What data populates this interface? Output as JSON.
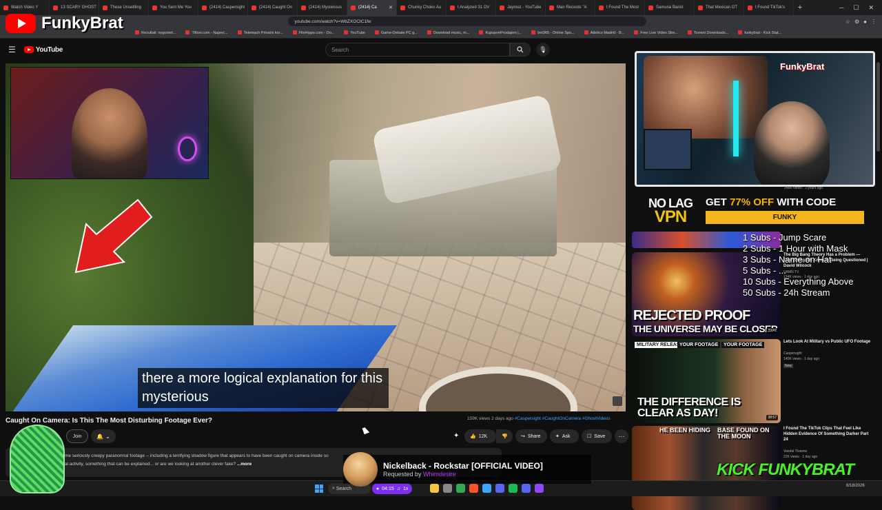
{
  "browser": {
    "tabs": [
      {
        "label": "Watch Video Y"
      },
      {
        "label": "13 SCARY GHOST"
      },
      {
        "label": "These Unsettling"
      },
      {
        "label": "You Sent Me You"
      },
      {
        "label": "(2414) Caspersight"
      },
      {
        "label": "(2414) Caught On"
      },
      {
        "label": "(2414) Mysterious"
      },
      {
        "label": "(2414) Ca",
        "active": true
      },
      {
        "label": "Chunky Choko Au"
      },
      {
        "label": "I Analyzed 31 OV"
      },
      {
        "label": "Jaymez - YouTube"
      },
      {
        "label": "Man Records \"A"
      },
      {
        "label": "I Found The Most"
      },
      {
        "label": "Samurai Barist"
      },
      {
        "label": "That Mexican OT"
      },
      {
        "label": "I Found TikTok's"
      }
    ],
    "url": "youtube.com/watch?v=WbZXOCIC1fw",
    "bookmarks": [
      "Rezultati: nogomet...",
      "Titlovi.com - Najveć...",
      "Telemach Privatni kor...",
      "FileHippo.com - Do...",
      "YouTube",
      "Game-Debate PC g...",
      "Download music, m...",
      "KupujemProdajem |...",
      "bet365 - Online Spo...",
      "Atletico Madrid - B...",
      "Free Live Video Stre...",
      "Torrent Downloads...",
      "funkybrat - Kick Stat..."
    ]
  },
  "overlay": {
    "channel_name": "FunkyBrat",
    "caption": "there a more logical explanation for this mysterious",
    "sub_goals": [
      "1 Subs - Jump Scare",
      "2 Subs - 1 Hour with Mask",
      "3 Subs - Name on Hat",
      "5 Subs - ...",
      "10 Subs - Everything Above",
      "50 Subs - 24h Stream"
    ],
    "promo": {
      "logo_top": "NO LAG",
      "logo_bottom": "VPN",
      "headline_prefix": "GET ",
      "headline_highlight": "77% OFF",
      "headline_suffix": " WITH CODE",
      "code": "FUNKY"
    },
    "song": {
      "title": "Nickelback - Rockstar [OFFICIAL VIDEO]",
      "requested_prefix": "Requested by ",
      "requester": "Whimdesire"
    },
    "kick_text": "KICK FUNKYBRAT",
    "sidecam_brand": "FunkyBrat"
  },
  "youtube": {
    "logo_text": "YouTube",
    "search_placeholder": "Search",
    "video_title": "Caught On Camera: Is This The Most Disturbing Footage Ever?",
    "views": "159K views",
    "age": "2 days ago",
    "hashtags": "#Caspersight #CaughtOnCamera #GhostVideos",
    "join_label": "Join",
    "likes": "12K",
    "share_label": "Share",
    "ask_label": "Ask",
    "save_label": "Save",
    "description_line1": "me seriously creepy paranormal footage -- including a terrifying shadow figure that appears to have been caught on camera inside so",
    "description_line2": "al activity, something that can be explained... or are we looking at another clever fake?",
    "description_more": "...more",
    "top_meta": "248K views · 3 years ago",
    "suggested": [
      {
        "title": "The Big Bang Theory Has a Problem — Everything We Know Is Being Questioned | David Wilcock",
        "channel": "UAMN TV",
        "meta": "134K views · 1 day ago",
        "duration": "29:47",
        "thumb_text_a": "REJECTED PROOF",
        "thumb_text_b": "THE UNIVERSE MAY BE CLOSER"
      },
      {
        "title": "Lets Look At Military vs Public UFO Footage",
        "channel": "Caspersight",
        "meta": "140K views · 1 day ago",
        "badge": "New",
        "duration": "38:57",
        "thumb_label_a": "MILITARY RELEASE",
        "thumb_label_b": "YOUR FOOTAGE",
        "thumb_label_c": "YOUR FOOTAGE",
        "thumb_text": "THE DIFFERENCE IS CLEAR AS DAY!"
      },
      {
        "title": "I Found The TikTok Clips That Feel Like Hidden Evidence Of Something Darker Part 24",
        "channel": "Vandal Thawne",
        "meta": "22K views · 1 day ago",
        "thumb_text_a": "HE BEEN HIDING",
        "thumb_text_b": "BASE FOUND ON THE MOON",
        "thumb_highlight": "FOUND"
      }
    ]
  },
  "taskbar": {
    "search": "Search",
    "timer": "04:15",
    "music": "1x",
    "date": "8/18/2026"
  },
  "colors": {
    "yt_red": "#ff0000",
    "promo_yellow": "#f3b61f",
    "kick_green": "#4af02a",
    "timer_purple": "#7c2ff0",
    "link_blue": "#3ea6ff"
  }
}
